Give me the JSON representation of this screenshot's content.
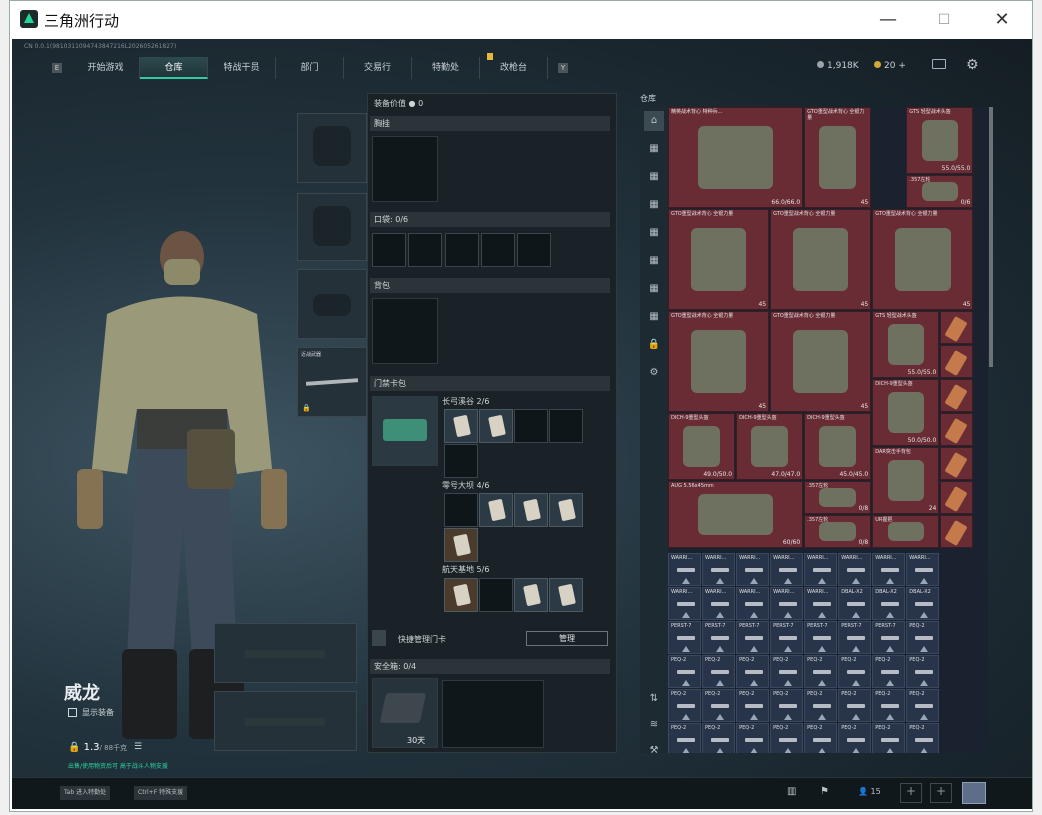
{
  "window": {
    "title": "三角洲行动",
    "minimize": "—",
    "maximize": "☐",
    "close": "✕"
  },
  "version_text": "CN 0.0.1(9810311094743847216L202605261827)",
  "nav": {
    "left_key": "E",
    "right_key": "Y",
    "tabs": [
      "开始游戏",
      "仓库",
      "特战干员",
      "部门",
      "交易行",
      "特勤处",
      "改枪台"
    ],
    "active": "仓库"
  },
  "currency": {
    "hafbucks": "1,918K",
    "coins": "20",
    "plus": "+"
  },
  "character": {
    "name": "威龙",
    "show_gear_label": "显示装备",
    "weight": "1.3",
    "weight_limit": "/ 88千克",
    "hint": "出售/使用物资后可 高于战斗人物支援"
  },
  "equipment": {
    "value_label": "装备价值",
    "value": "0",
    "chest_label": "胸挂",
    "pockets_label": "口袋: 0",
    "pockets_unit": "/6",
    "backpack_label": "背包",
    "keycard_label": "门禁卡包",
    "keycard_groups": [
      {
        "name": "长弓溪谷",
        "count": "2/6"
      },
      {
        "name": "零号大坝",
        "count": "4/6"
      },
      {
        "name": "航天基地",
        "count": "5/6"
      }
    ],
    "quick_manage_label": "快捷管理门卡",
    "manage_button": "管理",
    "safe_label": "安全箱: 0",
    "safe_unit": "/4",
    "safe_days": "30天",
    "melee_label": "近战武器"
  },
  "stash": {
    "title": "仓库",
    "items": [
      {
        "name": "精英战术背心 特种兵...",
        "value": "66.0/66.0"
      },
      {
        "name": "GTO重型战术背心 全银力量",
        "value": "45"
      },
      {
        "name": "GTS 轻型战术头盔",
        "value": "55.0/55.0"
      },
      {
        "name": ".357左轮",
        "value": "0/6"
      },
      {
        "name": "GTO重型战术背心 全银力量",
        "value": "45"
      },
      {
        "name": "GTO重型战术背心 全银力量",
        "value": "45"
      },
      {
        "name": "GTO重型战术背心 全银力量",
        "value": "45"
      },
      {
        "name": "GTO重型战术背心 全银力量",
        "value": "45"
      },
      {
        "name": "GTO重型战术背心 全银力量",
        "value": "45"
      },
      {
        "name": "GTS 轻型战术头盔",
        "value": "55.0/55.0"
      },
      {
        "name": "DICH-9重型头盔",
        "value": "50.0/50.0"
      },
      {
        "name": "DICH-9重型头盔",
        "value": "49.0/50.0"
      },
      {
        "name": "DICH-9重型头盔",
        "value": "47.0/47.0"
      },
      {
        "name": "DICH-9重型头盔",
        "value": "45.0/45.0"
      },
      {
        "name": "DAR突击手背包",
        "value": "24"
      },
      {
        "name": "AUG 5.56x45mm",
        "value": "60/60"
      },
      {
        "name": ".357左轮",
        "value": "0/8"
      },
      {
        "name": ".357左轮",
        "value": "0/8"
      },
      {
        "name": "UR握把",
        "value": ""
      }
    ],
    "attach_rows": [
      [
        "WARRI...",
        "WARRI...",
        "WARRI...",
        "WARRI...",
        "WARRI...",
        "WARRI...",
        "WARRI...",
        "WARRI..."
      ],
      [
        "WARRI...",
        "WARRI...",
        "WARRI...",
        "WARRI...",
        "WARRI...",
        "DBAL-X2",
        "DBAL-X2",
        "DBAL-X2"
      ],
      [
        "PERST-7",
        "PERST-7",
        "PERST-7",
        "PERST-7",
        "PERST-7",
        "PERST-7",
        "PERST-7",
        "PEQ-2"
      ],
      [
        "PEQ-2",
        "PEQ-2",
        "PEQ-2",
        "PEQ-2",
        "PEQ-2",
        "PEQ-2",
        "PEQ-2",
        "PEQ-2"
      ],
      [
        "PEQ-2",
        "PEQ-2",
        "PEQ-2",
        "PEQ-2",
        "PEQ-2",
        "PEQ-2",
        "PEQ-2",
        "PEQ-2"
      ],
      [
        "PEQ-2",
        "PEQ-2",
        "PEQ-2",
        "PEQ-2",
        "PEQ-2",
        "PEQ-2",
        "PEQ-2",
        "PEQ-2"
      ]
    ],
    "short_row_label": "战术握把"
  },
  "bottom_bar": {
    "tab_key": "Tab",
    "tab_label": "进入特勤处",
    "ctrl_key": "Ctrl+F",
    "ctrl_label": "特殊支援",
    "friends": "15"
  }
}
